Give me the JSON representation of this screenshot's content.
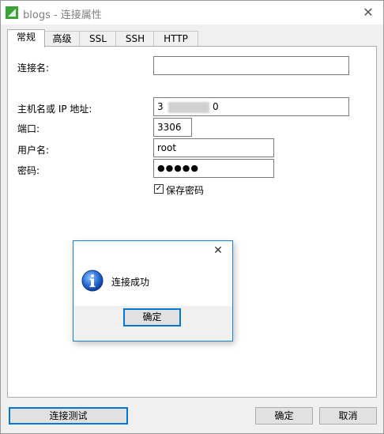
{
  "window": {
    "title": "blogs - 连接属性",
    "close_glyph": "✕"
  },
  "tabs": [
    {
      "label": "常规",
      "active": true
    },
    {
      "label": "高级",
      "active": false
    },
    {
      "label": "SSL",
      "active": false
    },
    {
      "label": "SSH",
      "active": false
    },
    {
      "label": "HTTP",
      "active": false
    }
  ],
  "form": {
    "connection_name": {
      "label": "连接名:",
      "value": ""
    },
    "host": {
      "label": "主机名或 IP 地址:",
      "value_start": "3",
      "value_end": "0"
    },
    "port": {
      "label": "端口:",
      "value": "3306"
    },
    "username": {
      "label": "用户名:",
      "value": "root"
    },
    "password": {
      "label": "密码:",
      "value": "●●●●●"
    },
    "save_password": {
      "label": "保存密码",
      "checked": true,
      "check_glyph": "✓"
    }
  },
  "buttons": {
    "test": "连接测试",
    "ok": "确定",
    "cancel": "取消"
  },
  "message_box": {
    "message": "连接成功",
    "ok": "确定",
    "close_glyph": "✕",
    "icon": "info-icon"
  },
  "colors": {
    "accent": "#0078d7",
    "app_icon": "#3aa33a"
  }
}
